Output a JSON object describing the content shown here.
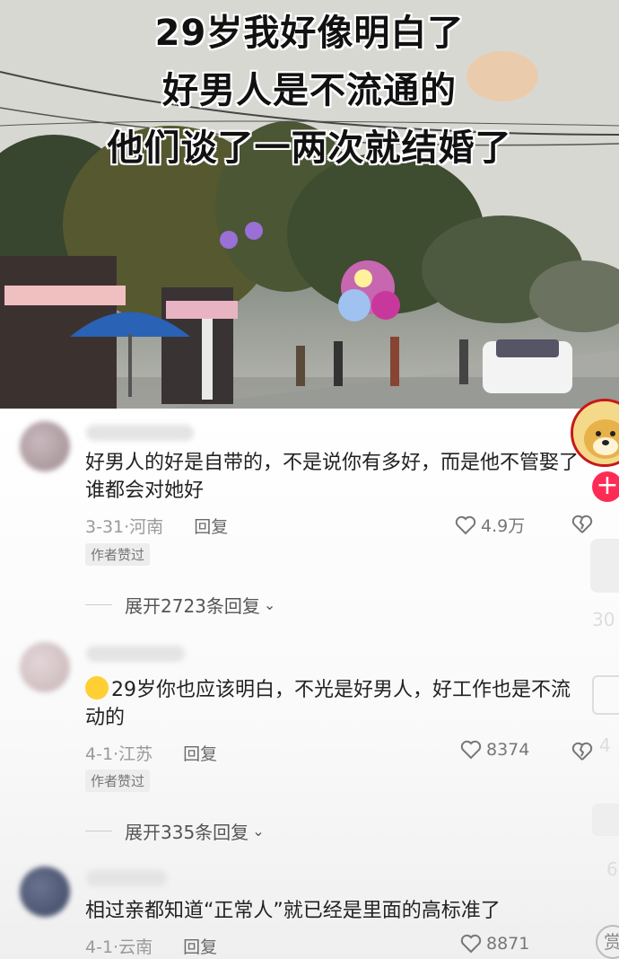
{
  "video": {
    "caption_lines": [
      "29岁我好像明白了",
      "好男人是不流通的",
      "他们谈了一两次就结婚了"
    ]
  },
  "comments": [
    {
      "text": "好男人的好是自带的，不是说你有多好，而是他不管娶了谁都会对她好",
      "date": "3-31·",
      "location": "河南",
      "reply_label": "回复",
      "likes": "4.9万",
      "badge": "作者赞过",
      "expand_label": "展开2723条回复"
    },
    {
      "emoji": "grinning-face-icon",
      "text": "29岁你也应该明白，不光是好男人，好工作也是不流动的",
      "date": "4-1·",
      "location": "江苏",
      "reply_label": "回复",
      "likes": "8374",
      "badge": "作者赞过",
      "expand_label": "展开335条回复"
    },
    {
      "text": "相过亲都知道“正常人”就已经是里面的高标准了",
      "date": "4-1·",
      "location": "云南",
      "reply_label": "回复",
      "likes": "8871"
    }
  ],
  "side_bar": {
    "follow_symbol": "+",
    "counts": [
      "30",
      "4",
      "6"
    ],
    "reward_label": "赏"
  },
  "colors": {
    "follow": "#fe2c55",
    "avatar_ring": "#c6181b"
  }
}
